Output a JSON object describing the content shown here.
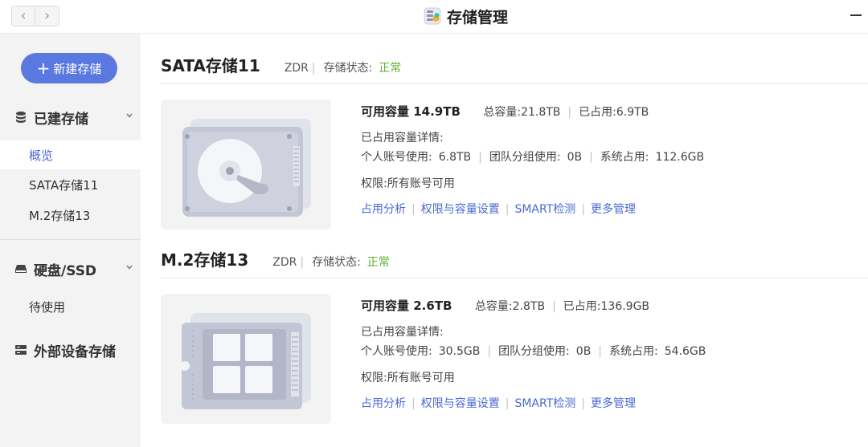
{
  "window": {
    "title": "存储管理",
    "back": "‹",
    "forward": "›"
  },
  "sidebar": {
    "new_button": "新建存储",
    "groups": [
      {
        "label": "已建存储",
        "items": [
          "概览",
          "SATA存储11",
          "M.2存储13"
        ]
      },
      {
        "label": "硬盘/SSD",
        "items": [
          "待使用"
        ]
      },
      {
        "label": "外部设备存储",
        "items": []
      }
    ]
  },
  "storages": [
    {
      "name": "SATA存储11",
      "type": "ZDR",
      "status_label": "存储状态:",
      "status": "正常",
      "available": "可用容量 14.9TB",
      "total_label": "总容量:",
      "total": "21.8TB",
      "used_label": "已占用:",
      "used": "6.9TB",
      "detail_title": "已占用容量详情:",
      "personal_label": "个人账号使用:",
      "personal": "6.8TB",
      "team_label": "团队分组使用:",
      "team": "0B",
      "system_label": "系统占用:",
      "system": "112.6GB",
      "permission": "权限:所有账号可用",
      "links": [
        "占用分析",
        "权限与容量设置",
        "SMART检测",
        "更多管理"
      ]
    },
    {
      "name": "M.2存储13",
      "type": "ZDR",
      "status_label": "存储状态:",
      "status": "正常",
      "available": "可用容量 2.6TB",
      "total_label": "总容量:",
      "total": "2.8TB",
      "used_label": "已占用:",
      "used": "136.9GB",
      "detail_title": "已占用容量详情:",
      "personal_label": "个人账号使用:",
      "personal": "30.5GB",
      "team_label": "团队分组使用:",
      "team": "0B",
      "system_label": "系统占用:",
      "system": "54.6GB",
      "permission": "权限:所有账号可用",
      "links": [
        "占用分析",
        "权限与容量设置",
        "SMART检测",
        "更多管理"
      ]
    }
  ],
  "icons": [
    "chevron-left-icon",
    "chevron-right-icon",
    "storage-app-icon",
    "minimize-icon",
    "plus-icon",
    "database-icon",
    "drive-icon",
    "external-storage-icon",
    "chevron-down-icon",
    "hdd-illustration",
    "m2-ssd-illustration"
  ],
  "colors": {
    "accent": "#5a79e0",
    "link": "#4a68d4",
    "ok": "#59b22c"
  }
}
